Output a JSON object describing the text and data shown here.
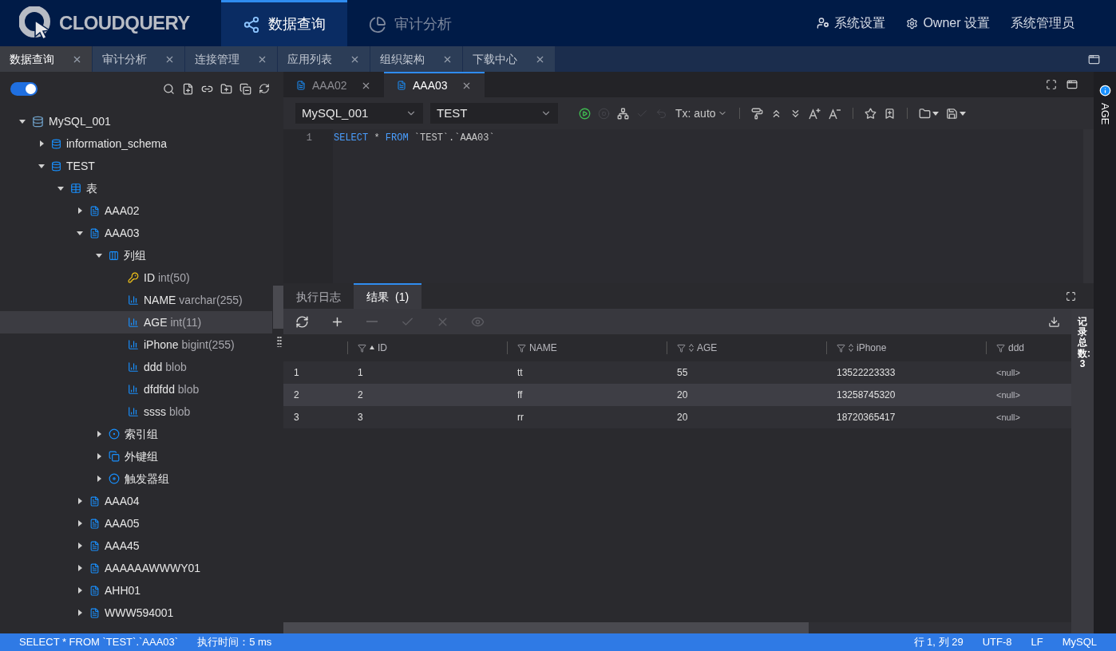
{
  "header": {
    "logo_text": "CLOUDQUERY",
    "nav": [
      {
        "label": "数据查询",
        "kind": "query",
        "selected": true
      },
      {
        "label": "审计分析",
        "kind": "audit",
        "selected": false
      }
    ],
    "links": [
      {
        "label": "系统设置",
        "kind": "user-settings"
      },
      {
        "label": "Owner 设置",
        "kind": "owner-settings"
      },
      {
        "label": "系统管理员",
        "kind": "text"
      }
    ]
  },
  "page_tabs": [
    {
      "label": "数据查询",
      "selected": true
    },
    {
      "label": "审计分析",
      "selected": false
    },
    {
      "label": "连接管理",
      "selected": false
    },
    {
      "label": "应用列表",
      "selected": false
    },
    {
      "label": "组织架构",
      "selected": false
    },
    {
      "label": "下载中心",
      "selected": false
    }
  ],
  "sidebar": {
    "dark_mode": true,
    "tree": [
      {
        "label": "MySQL_001",
        "kind": "server",
        "expanded": true,
        "selected": false,
        "children": [
          {
            "label": "information_schema",
            "kind": "database",
            "expanded": false,
            "selected": false
          },
          {
            "label": "TEST",
            "kind": "database",
            "expanded": true,
            "selected": false,
            "children": [
              {
                "label": "表",
                "kind": "table-group",
                "expanded": true,
                "selected": false,
                "children": [
                  {
                    "label": "AAA02",
                    "kind": "table",
                    "expanded": false,
                    "selected": false
                  },
                  {
                    "label": "AAA03",
                    "kind": "table",
                    "expanded": true,
                    "selected": false,
                    "children": [
                      {
                        "label": "列组",
                        "kind": "column-group",
                        "expanded": true,
                        "selected": false,
                        "children": [
                          {
                            "label": "ID",
                            "type": "int(50)",
                            "kind": "key-column",
                            "selected": false
                          },
                          {
                            "label": "NAME",
                            "type": "varchar(255)",
                            "kind": "column",
                            "selected": false
                          },
                          {
                            "label": "AGE",
                            "type": "int(11)",
                            "kind": "column",
                            "selected": true
                          },
                          {
                            "label": "iPhone",
                            "type": "bigint(255)",
                            "kind": "column",
                            "selected": false
                          },
                          {
                            "label": "ddd",
                            "type": "blob",
                            "kind": "column",
                            "selected": false
                          },
                          {
                            "label": "dfdfdd",
                            "type": "blob",
                            "kind": "column",
                            "selected": false
                          },
                          {
                            "label": "ssss",
                            "type": "blob",
                            "kind": "column",
                            "selected": false
                          }
                        ]
                      },
                      {
                        "label": "索引组",
                        "kind": "index-group",
                        "expanded": false,
                        "selected": false
                      },
                      {
                        "label": "外键组",
                        "kind": "fk-group",
                        "expanded": false,
                        "selected": false
                      },
                      {
                        "label": "触发器组",
                        "kind": "trigger-group",
                        "expanded": false,
                        "selected": false
                      }
                    ]
                  },
                  {
                    "label": "AAA04",
                    "kind": "table",
                    "expanded": false,
                    "selected": false
                  },
                  {
                    "label": "AAA05",
                    "kind": "table",
                    "expanded": false,
                    "selected": false
                  },
                  {
                    "label": "AAA45",
                    "kind": "table",
                    "expanded": false,
                    "selected": false
                  },
                  {
                    "label": "AAAAAAWWWY01",
                    "kind": "table",
                    "expanded": false,
                    "selected": false
                  },
                  {
                    "label": "AHH01",
                    "kind": "table",
                    "expanded": false,
                    "selected": false
                  },
                  {
                    "label": "WWW594001",
                    "kind": "table",
                    "expanded": false,
                    "selected": false
                  }
                ]
              }
            ]
          }
        ]
      }
    ]
  },
  "editor_tabs": [
    {
      "label": "AAA02",
      "selected": false
    },
    {
      "label": "AAA03",
      "selected": true
    }
  ],
  "editor_toolbar": {
    "connection": "MySQL_001",
    "database": "TEST",
    "tx_mode": "Tx: auto",
    "buttons": [
      {
        "kind": "run",
        "disabled": false
      },
      {
        "kind": "stop",
        "disabled": true
      },
      {
        "kind": "plan",
        "disabled": false
      },
      {
        "kind": "commit",
        "disabled": true
      },
      {
        "kind": "rollback",
        "disabled": true
      },
      {
        "kind": "tx"
      },
      {
        "kind": "sep"
      },
      {
        "kind": "format",
        "disabled": false
      },
      {
        "kind": "collapse",
        "disabled": false
      },
      {
        "kind": "expand",
        "disabled": false
      },
      {
        "kind": "font-up",
        "disabled": false
      },
      {
        "kind": "font-down",
        "disabled": false
      },
      {
        "kind": "sep"
      },
      {
        "kind": "favorite",
        "disabled": false
      },
      {
        "kind": "add-favorite",
        "disabled": false
      },
      {
        "kind": "sep"
      },
      {
        "kind": "open",
        "disabled": false
      },
      {
        "kind": "save",
        "disabled": false
      }
    ]
  },
  "editor": {
    "lines": [
      {
        "number": "1",
        "tokens": [
          {
            "kind": "keyword",
            "text": "SELECT"
          },
          {
            "kind": "plain",
            "text": " * "
          },
          {
            "kind": "keyword",
            "text": "FROM"
          },
          {
            "kind": "plain",
            "text": " `TEST`.`AAA03`"
          }
        ]
      }
    ]
  },
  "result_tabs": [
    {
      "label": "执行日志",
      "selected": false
    },
    {
      "label": "结果",
      "count": "(1)",
      "selected": true
    }
  ],
  "result_toolbar": [
    {
      "kind": "refresh",
      "disabled": false
    },
    {
      "kind": "add",
      "disabled": false
    },
    {
      "kind": "remove",
      "disabled": true
    },
    {
      "kind": "confirm",
      "disabled": true
    },
    {
      "kind": "cancel",
      "disabled": true
    },
    {
      "kind": "view",
      "disabled": true
    }
  ],
  "table": {
    "columns": [
      {
        "label": "ID",
        "sorted_ascending": true
      },
      {
        "label": "NAME",
        "sortable": false
      },
      {
        "label": "AGE",
        "sortable": true
      },
      {
        "label": "iPhone",
        "sortable": true
      },
      {
        "label": "ddd",
        "sortable": false
      }
    ],
    "rows": [
      {
        "index": "1",
        "selected": false,
        "cells": [
          "1",
          "tt",
          "55",
          "13522223333",
          "<null>"
        ]
      },
      {
        "index": "2",
        "selected": true,
        "cells": [
          "2",
          "ff",
          "20",
          "13258745320",
          "<null>"
        ]
      },
      {
        "index": "3",
        "selected": false,
        "cells": [
          "3",
          "rr",
          "20",
          "18720365417",
          "<null>"
        ]
      }
    ],
    "total": "记录总数: 3"
  },
  "right_panel": {
    "label": "AGE"
  },
  "status_bar": {
    "left": [
      "SELECT * FROM `TEST`.`AAA03`",
      "执行时间：5 ms"
    ],
    "right": [
      "行 1, 列 29",
      "UTF-8",
      "LF",
      "MySQL"
    ]
  }
}
